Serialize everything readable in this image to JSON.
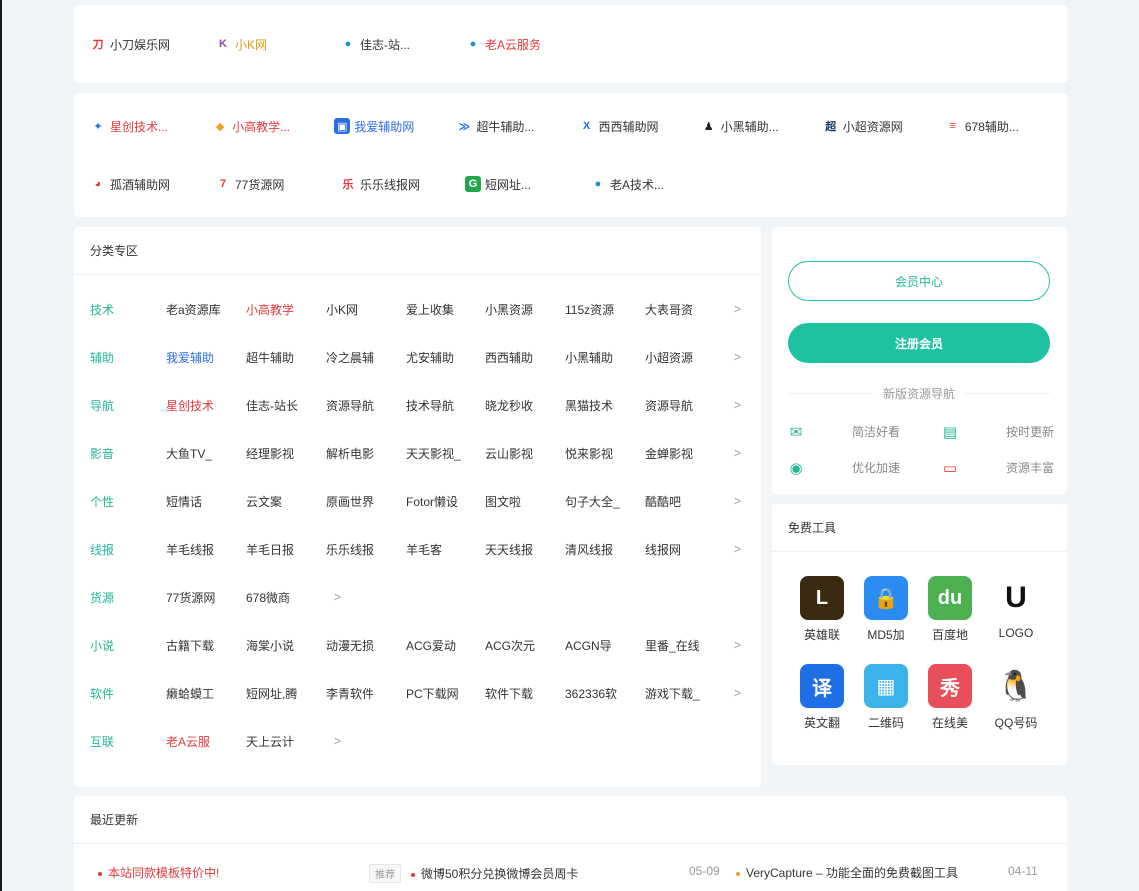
{
  "friend_links_row1": [
    {
      "icon": "xiaodao-logo-icon",
      "label": "小刀娱乐网",
      "color": "#333333"
    },
    {
      "icon": "k-logo-icon",
      "label": "小K网",
      "color": "#d4a017"
    },
    {
      "icon": "drop-icon",
      "label": "佳志-站...",
      "color": "#333333"
    },
    {
      "icon": "drop-icon",
      "label": "老A云服务",
      "color": "#e4393c"
    }
  ],
  "friend_links_row2": [
    {
      "icon": "xingchuang-logo-icon",
      "label": "星创技术...",
      "color": "#e4393c"
    },
    {
      "icon": "xiaogao-logo-icon",
      "label": "小高教学...",
      "color": "#e4393c"
    },
    {
      "icon": "woai-logo-icon",
      "label": "我爱辅助网",
      "color": "#2b6de5"
    },
    {
      "icon": "chaoniu-logo-icon",
      "label": "超牛辅助...",
      "color": "#333333"
    },
    {
      "icon": "xixi-logo-icon",
      "label": "西西辅助网",
      "color": "#333333"
    },
    {
      "icon": "person-icon",
      "label": "小黑辅助...",
      "color": "#333333"
    },
    {
      "icon": "xiaochao-logo-icon",
      "label": "小超资源网",
      "color": "#333333"
    },
    {
      "icon": "678-logo-icon",
      "label": "678辅助...",
      "color": "#333333"
    }
  ],
  "friend_links_row3": [
    {
      "icon": "penguin-icon",
      "label": "孤酒辅助网",
      "color": "#333333"
    },
    {
      "icon": "seven-logo-icon",
      "label": "77货源网",
      "color": "#333333"
    },
    {
      "icon": "lele-logo-icon",
      "label": "乐乐线报网",
      "color": "#333333"
    },
    {
      "icon": "g-logo-icon",
      "label": "短网址...",
      "color": "#333333"
    },
    {
      "icon": "drop-icon",
      "label": "老A技术...",
      "color": "#333333"
    }
  ],
  "categories": {
    "title": "分类专区",
    "more": ">",
    "rows": [
      {
        "name": "技术",
        "items": [
          "老a资源库",
          "小高教学",
          "小K网",
          "爱上收集",
          "小黑资源",
          "115z资源",
          "大表哥资"
        ],
        "colors": [
          "#333333",
          "#e4393c",
          "#333333",
          "#333333",
          "#333333",
          "#333333",
          "#333333"
        ],
        "more": true
      },
      {
        "name": "辅助",
        "items": [
          "我爱辅助",
          "超牛辅助",
          "冷之晨辅",
          "尤安辅助",
          "西西辅助",
          "小黑辅助",
          "小超资源"
        ],
        "colors": [
          "#2b6de5",
          "#333333",
          "#333333",
          "#333333",
          "#333333",
          "#333333",
          "#333333"
        ],
        "more": true
      },
      {
        "name": "导航",
        "items": [
          "星创技术",
          "佳志-站长",
          "资源导航",
          "技术导航",
          "晓龙秒收",
          "黑猫技术",
          "资源导航"
        ],
        "colors": [
          "#e4393c",
          "#333333",
          "#333333",
          "#333333",
          "#333333",
          "#333333",
          "#333333"
        ],
        "more": true
      },
      {
        "name": "影音",
        "items": [
          "大鱼TV_",
          "经理影视",
          "解析电影",
          "天天影视_",
          "云山影视",
          "悦来影视",
          "金蝉影视"
        ],
        "colors": [
          "#333333",
          "#333333",
          "#333333",
          "#333333",
          "#333333",
          "#333333",
          "#333333"
        ],
        "more": true
      },
      {
        "name": "个性",
        "items": [
          "短情话",
          "云文案",
          "原画世界",
          "Fotor懒设",
          "图文啦",
          "句子大全_",
          "酷酷吧"
        ],
        "colors": [
          "#333333",
          "#333333",
          "#333333",
          "#333333",
          "#333333",
          "#333333",
          "#333333"
        ],
        "more": true
      },
      {
        "name": "线报",
        "items": [
          "羊毛线报",
          "羊毛日报",
          "乐乐线报",
          "羊毛客",
          "天天线报",
          "清风线报",
          "线报网"
        ],
        "colors": [
          "#333333",
          "#333333",
          "#333333",
          "#333333",
          "#333333",
          "#333333",
          "#333333"
        ],
        "more": true
      },
      {
        "name": "货源",
        "items": [
          "77货源网",
          "678微商"
        ],
        "colors": [
          "#333333",
          "#333333"
        ],
        "more": true
      },
      {
        "name": "小说",
        "items": [
          "古籍下载",
          "海棠小说",
          "动漫无损",
          "ACG爱动",
          "ACG次元",
          "ACGN导",
          "里番_在线"
        ],
        "colors": [
          "#333333",
          "#333333",
          "#333333",
          "#333333",
          "#333333",
          "#333333",
          "#333333"
        ],
        "more": true
      },
      {
        "name": "软件",
        "items": [
          "癞蛤蟆工",
          "短网址,腾",
          "李青软件",
          "PC下载网",
          "软件下载",
          "362336软",
          "游戏下载_"
        ],
        "colors": [
          "#333333",
          "#333333",
          "#333333",
          "#333333",
          "#333333",
          "#333333",
          "#333333"
        ],
        "more": true
      },
      {
        "name": "互联",
        "items": [
          "老A云服",
          "天上云计"
        ],
        "colors": [
          "#e4393c",
          "#333333"
        ],
        "more": true
      }
    ]
  },
  "member": {
    "center_label": "会员中心",
    "register_label": "注册会员",
    "divider_label": "新版资源导航",
    "features": [
      {
        "icon": "mail-icon",
        "label": "简洁好看",
        "color": "#22b797"
      },
      {
        "icon": "clipboard-icon",
        "label": "按时更新",
        "color": "#22b797"
      },
      {
        "icon": "vip-icon",
        "label": "优化加速",
        "color": "#22b797"
      },
      {
        "icon": "laptop-icon",
        "label": "资源丰富",
        "color": "#e4393c"
      }
    ]
  },
  "tools": {
    "title": "免费工具",
    "items": [
      {
        "label": "英雄联",
        "glyph": "L",
        "icon": "lol-icon",
        "bg": "#3a2a12"
      },
      {
        "label": "MD5加",
        "glyph": "🔒",
        "icon": "md5-lock-icon",
        "bg": "#2a8cf0"
      },
      {
        "label": "百度地",
        "glyph": "du",
        "icon": "baidu-map-icon",
        "bg": "#4caf50"
      },
      {
        "label": "LOGO",
        "glyph": "U",
        "icon": "logo-maker-icon",
        "bg": "#ffffff"
      },
      {
        "label": "英文翻",
        "glyph": "译",
        "icon": "translate-icon",
        "bg": "#1e6fe6"
      },
      {
        "label": "二维码",
        "glyph": "▦",
        "icon": "qrcode-icon",
        "bg": "#3bb3ea"
      },
      {
        "label": "在线美",
        "glyph": "秀",
        "icon": "meitu-icon",
        "bg": "#e84f5a"
      },
      {
        "label": "QQ号码",
        "glyph": "🐧",
        "icon": "qq-icon",
        "bg": "#ffffff"
      }
    ]
  },
  "updates": {
    "title": "最近更新",
    "items": [
      {
        "text": "本站同款模板特价中!",
        "color": "#e4393c",
        "dot": "#e4393c"
      },
      {
        "badge": "推荐",
        "text": "微博50积分兑换微博会员周卡",
        "date": "05-09",
        "color": "#333333",
        "dot": "#e4393c"
      },
      {
        "text": "VeryCapture – 功能全面的免费截图工具",
        "date": "04-11",
        "color": "#333333",
        "dot": "#f0a020"
      }
    ]
  }
}
